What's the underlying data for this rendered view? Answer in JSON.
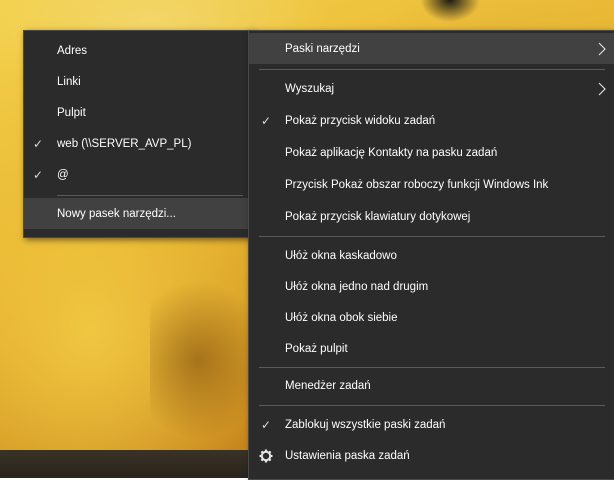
{
  "toolbars_menu": {
    "items": [
      {
        "label": "Adres",
        "checked": false
      },
      {
        "label": "Linki",
        "checked": false
      },
      {
        "label": "Pulpit",
        "checked": false
      },
      {
        "label": "web (\\\\SERVER_AVP_PL)",
        "checked": true
      },
      {
        "label": "@",
        "checked": true
      }
    ],
    "new_toolbar": "Nowy pasek narzędzi..."
  },
  "main_menu": {
    "toolbars": "Paski narzędzi",
    "search": "Wyszukaj",
    "show_task_view": "Pokaż przycisk widoku zadań",
    "show_people": "Pokaż aplikację Kontakty na pasku zadań",
    "show_ink": "Przycisk Pokaż obszar roboczy funkcji Windows Ink",
    "show_keyboard": "Pokaż przycisk klawiatury dotykowej",
    "cascade": "Ułóż okna kaskadowo",
    "stacked": "Ułóż okna jedno nad drugim",
    "side_by_side": "Ułóż okna obok siebie",
    "show_desktop": "Pokaż pulpit",
    "task_manager": "Menedżer zadań",
    "lock_taskbars": "Zablokuj wszystkie paski zadań",
    "taskbar_settings": "Ustawienia paska zadań"
  },
  "check_glyph": "✓",
  "colors": {
    "menu_bg": "#2b2b2b",
    "highlight": "#414141",
    "text": "#ffffff"
  }
}
